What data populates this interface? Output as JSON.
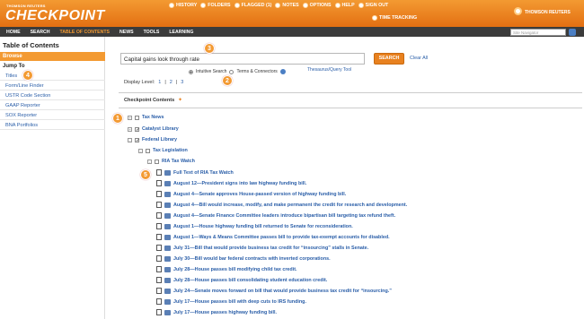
{
  "brand": {
    "small": "THOMSON REUTERS",
    "name": "CHECKPOINT",
    "logo_text": "THOMSON REUTERS"
  },
  "toplinks": [
    "HISTORY",
    "FOLDERS",
    "FLAGGED (1)",
    "NOTES",
    "OPTIONS",
    "HELP",
    "SIGN OUT"
  ],
  "time_tracking": "TIME TRACKING",
  "nav": [
    "HOME",
    "SEARCH",
    "TABLE OF CONTENTS",
    "NEWS",
    "TOOLS",
    "LEARNING"
  ],
  "site_navigator": "Site Navigator",
  "sidebar": {
    "title": "Table of Contents",
    "browse": "Browse",
    "jump_to": "Jump To",
    "items": [
      "Titles",
      "Form/Line Finder",
      "USTR Code Section",
      "GAAP Reporter",
      "SOX Reporter",
      "BNA Portfolios"
    ]
  },
  "search": {
    "value": "Capital gains look through rate",
    "button": "SEARCH",
    "clear": "Clear All",
    "opt1": "Intuitive Search",
    "opt2": "Terms & Connectors",
    "thesaurus": "Thesaurus/Query Tool"
  },
  "display_level": {
    "label": "Display Level:",
    "levels": [
      "1",
      "2",
      "3"
    ]
  },
  "contents_title": "Checkpoint Contents",
  "tree": [
    {
      "label": "Tax News"
    },
    {
      "label": "Catalyst Library"
    },
    {
      "label": "Federal Library"
    },
    {
      "label": "Tax Legislation"
    },
    {
      "label": "RIA Tax Watch"
    }
  ],
  "docs": [
    "Full Text of RIA Tax Watch",
    "August 12—President signs into law highway funding bill.",
    "August 4—Senate approves House-passed version of highway funding bill.",
    "August 4—Bill would increase, modify, and make permanent the credit for research and development.",
    "August 4—Senate Finance Committee leaders introduce bipartisan bill targeting tax refund theft.",
    "August 1—House highway funding bill returned to Senate for reconsideration.",
    "August 1—Ways & Means Committee passes bill to provide tax-exempt accounts for disabled.",
    "July 31—Bill that would provide business tax credit for “insourcing” stalls in Senate.",
    "July 30—Bill would bar federal contracts with inverted corporations.",
    "July 28—House passes bill modifying child tax credit.",
    "July 28—House passes bill consolidating student education credit.",
    "July 24—Senate moves forward on bill that would provide business tax credit for “insourcing.”",
    "July 17—House passes bill with deep cuts to IRS funding.",
    "July 17—House passes highway funding bill."
  ],
  "badges": [
    "1",
    "2",
    "3",
    "4",
    "5"
  ]
}
